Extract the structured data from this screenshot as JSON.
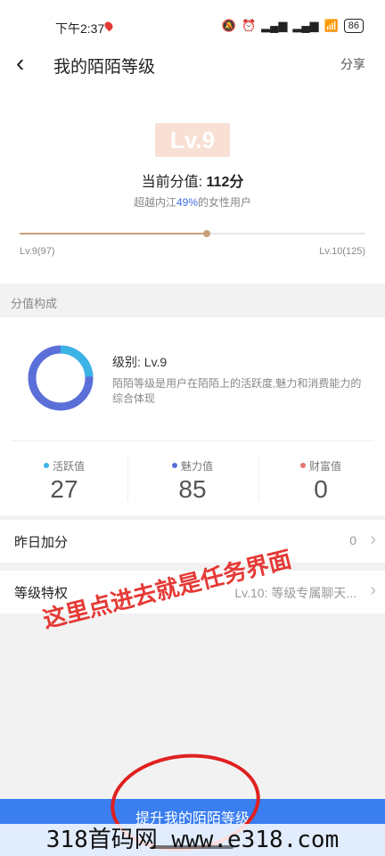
{
  "status_bar": {
    "time": "下午2:37",
    "icons": [
      "location-pin-icon",
      "mute-icon",
      "alarm-icon",
      "hd-signal-icon",
      "hd-signal-icon",
      "wifi-icon"
    ],
    "battery": "86"
  },
  "header": {
    "back_icon": "chevron-left-icon",
    "title": "我的陌陌等级",
    "share_label": "分享"
  },
  "level": {
    "badge": "Lv.9",
    "score_prefix": "当前分值: ",
    "score_value": "112分",
    "beat_prefix": "超越内江",
    "beat_pct": "49%",
    "beat_suffix": "的女性用户",
    "progress": 0.54,
    "min_label": "Lv.9(97)",
    "max_label": "Lv.10(125)",
    "progress_color": "#c8a07a"
  },
  "composition": {
    "section_title": "分值构成",
    "level_text": "级别: Lv.9",
    "description": "陌陌等级是用户在陌陌上的活跃度,魅力和消费能力的综合体现",
    "stats": [
      {
        "label": "活跃值",
        "value": "27",
        "color": "#3bb3e6"
      },
      {
        "label": "魅力值",
        "value": "85",
        "color": "#5b6fd8"
      },
      {
        "label": "财富值",
        "value": "0",
        "color": "#e57373"
      }
    ]
  },
  "rows": {
    "yesterday": {
      "label": "昨日加分",
      "value": "0"
    },
    "privilege": {
      "label": "等级特权",
      "value": "Lv.10: 等级专属聊天..."
    }
  },
  "annotation": "这里点进去就是任务界面",
  "cta_label": "提升我的陌陌等级",
  "watermark": "318首码网 www.e318.com"
}
